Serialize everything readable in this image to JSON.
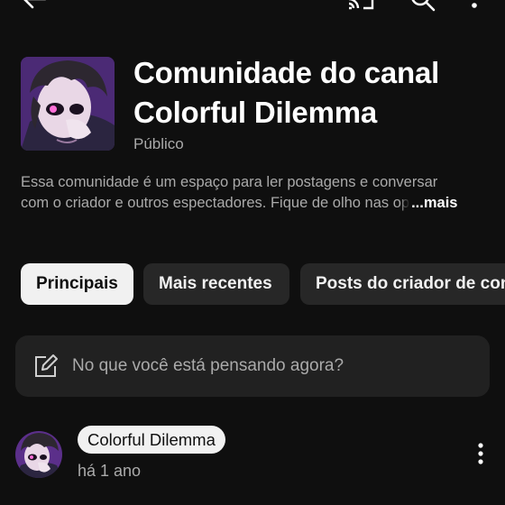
{
  "header": {
    "title_line1": "Comunidade do canal",
    "title_line2": "Colorful Dilemma",
    "visibility": "Público",
    "description_line1": "Essa comunidade é um espaço para ler postagens e conversar",
    "description_line2_visible": "com o criador e outros espectadores. Fique de olho nas ",
    "description_line2_fading": "op",
    "more_label": "...mais"
  },
  "topbar": {
    "icons": [
      "back-arrow-icon",
      "cast-icon",
      "search-icon",
      "more-vert-icon"
    ]
  },
  "tabs": [
    {
      "label": "Principais",
      "active": true
    },
    {
      "label": "Mais recentes",
      "active": false
    },
    {
      "label": "Posts do criador de conteúdo",
      "active": false
    }
  ],
  "composer": {
    "placeholder": "No que você está pensando agora?"
  },
  "post": {
    "author": "Colorful Dilemma",
    "time": "há 1 ano"
  },
  "colors": {
    "background": "#0f0f0f",
    "chip_bg": "#272727",
    "chip_active_bg": "#f1f1f1",
    "secondary_text": "#aaaaaa",
    "composer_bg": "#212121"
  }
}
